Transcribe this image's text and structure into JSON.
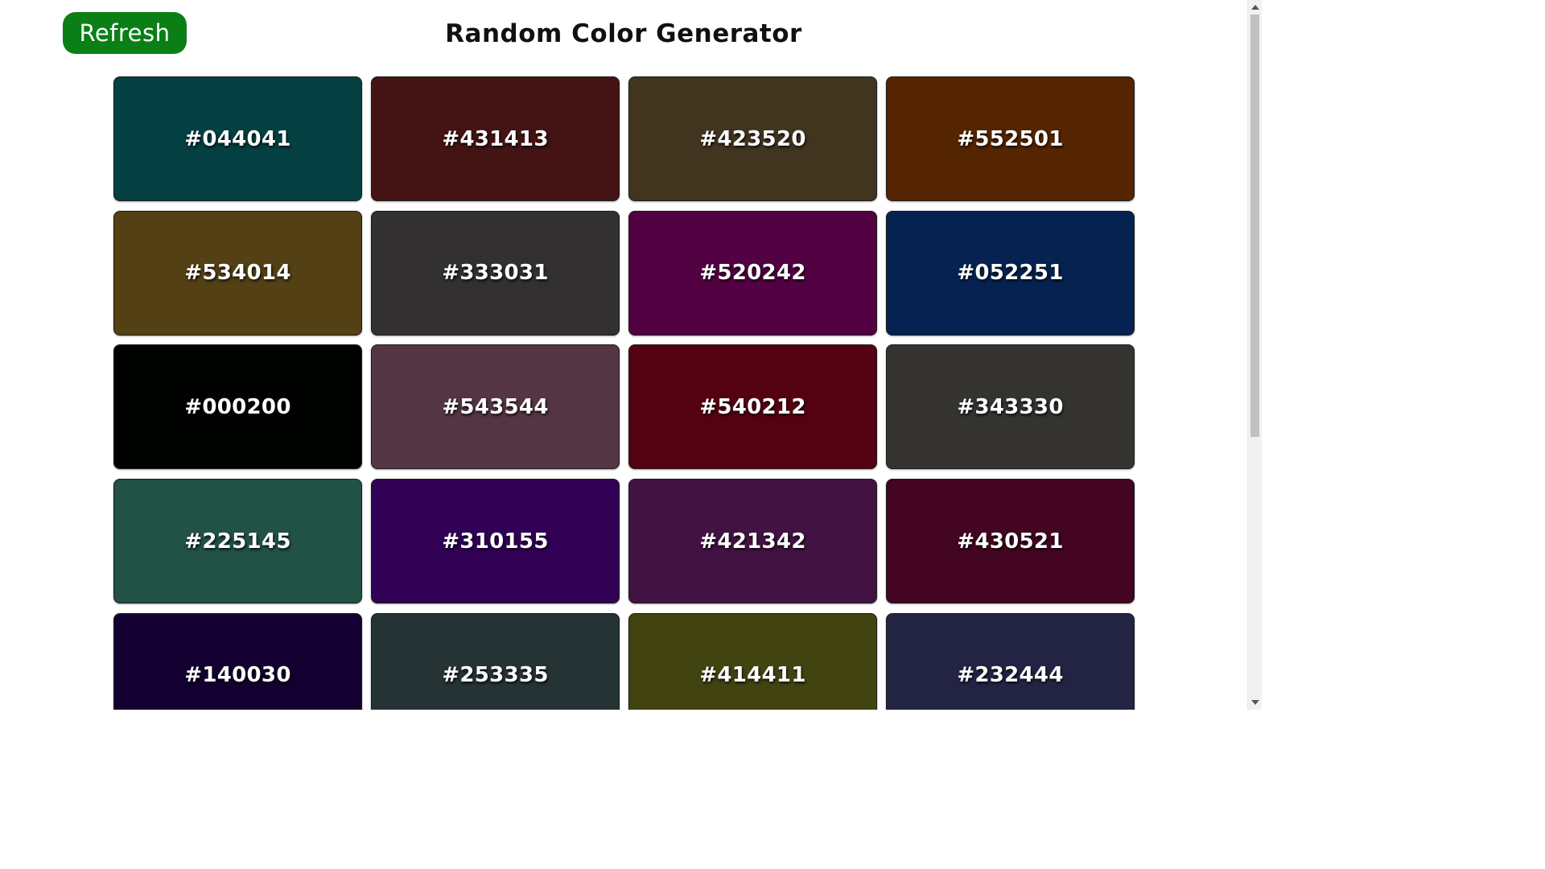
{
  "app": {
    "title": "Random Color Generator",
    "refresh_label": "Refresh",
    "refresh_color": "#0a7f15"
  },
  "swatches": [
    {
      "label": "#044041",
      "color": "#044041"
    },
    {
      "label": "#431413",
      "color": "#431413"
    },
    {
      "label": "#423520",
      "color": "#423520"
    },
    {
      "label": "#552501",
      "color": "#552501"
    },
    {
      "label": "#534014",
      "color": "#534014"
    },
    {
      "label": "#333031",
      "color": "#333031"
    },
    {
      "label": "#520242",
      "color": "#520242"
    },
    {
      "label": "#052251",
      "color": "#052251"
    },
    {
      "label": "#000200",
      "color": "#000200"
    },
    {
      "label": "#543544",
      "color": "#543544"
    },
    {
      "label": "#540212",
      "color": "#540212"
    },
    {
      "label": "#343330",
      "color": "#343330"
    },
    {
      "label": "#225145",
      "color": "#225145"
    },
    {
      "label": "#310155",
      "color": "#310155"
    },
    {
      "label": "#421342",
      "color": "#421342"
    },
    {
      "label": "#430521",
      "color": "#430521"
    },
    {
      "label": "#140030",
      "color": "#140030"
    },
    {
      "label": "#253335",
      "color": "#253335"
    },
    {
      "label": "#414411",
      "color": "#414411"
    },
    {
      "label": "#232444",
      "color": "#232444"
    }
  ]
}
